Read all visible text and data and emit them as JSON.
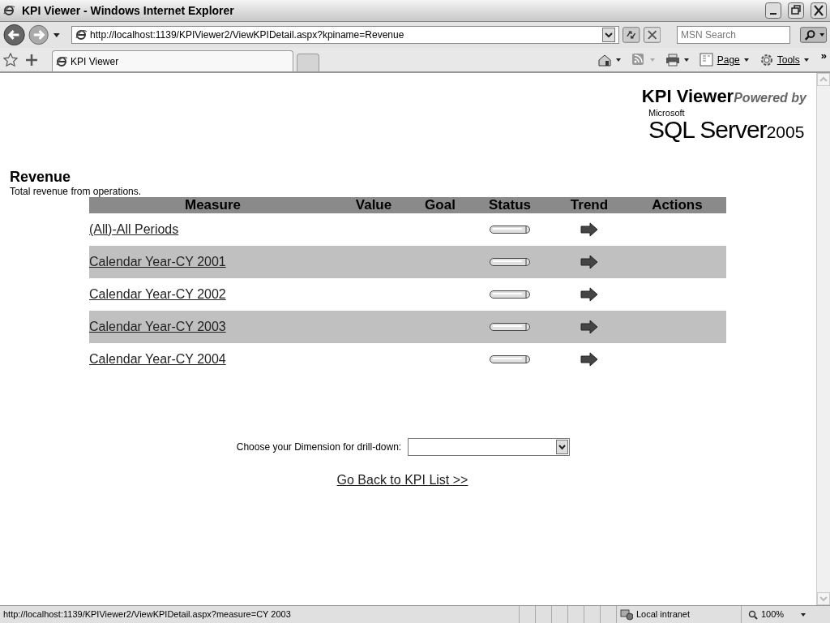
{
  "window": {
    "title": "KPI Viewer - Windows Internet Explorer"
  },
  "address_bar": {
    "url": "http://localhost:1139/KPIViewer2/ViewKPIDetail.aspx?kpiname=Revenue"
  },
  "search": {
    "placeholder": "MSN Search"
  },
  "tabs": [
    {
      "label": "KPI Viewer",
      "selected": true
    }
  ],
  "command_bar": [
    {
      "kind": "home"
    },
    {
      "kind": "feeds"
    },
    {
      "kind": "print"
    },
    {
      "kind": "page",
      "label": "Page"
    },
    {
      "kind": "tools",
      "label": "Tools"
    }
  ],
  "chevron": "»",
  "header": {
    "title": "KPI Viewer",
    "tagline": "Powered by",
    "logo_small": "Microsoft",
    "logo_main": "SQL Server",
    "logo_year": "2005"
  },
  "kpi": {
    "name": "Revenue",
    "description": "Total revenue from operations."
  },
  "table": {
    "columns": [
      "Measure",
      "Value",
      "Goal",
      "Status",
      "Trend",
      "Actions"
    ],
    "rows": [
      {
        "measure": "(All)-All Periods"
      },
      {
        "measure": "Calendar Year-CY 2001"
      },
      {
        "measure": "Calendar Year-CY 2002"
      },
      {
        "measure": "Calendar Year-CY 2003"
      },
      {
        "measure": "Calendar Year-CY 2004"
      }
    ]
  },
  "drilldown": {
    "label": "Choose your Dimension for drill-down:"
  },
  "back_link": "Go Back to KPI List >>",
  "status_bar": {
    "url": "http://localhost:1139/KPIViewer2/ViewKPIDetail.aspx?measure=CY 2003",
    "zone": "Local intranet",
    "zoom": "100%"
  }
}
